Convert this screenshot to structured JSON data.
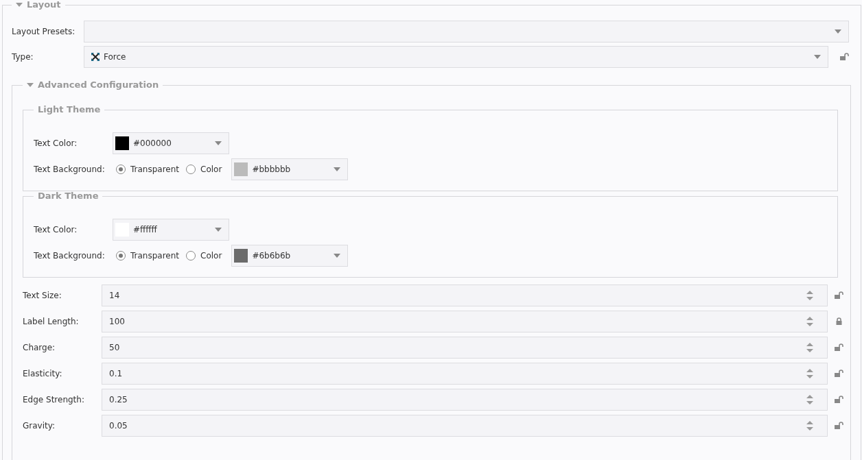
{
  "section": {
    "title": "Layout",
    "expanded": true
  },
  "presets": {
    "label": "Layout Presets:"
  },
  "type": {
    "label": "Type:",
    "value": "Force",
    "locked": false
  },
  "advanced": {
    "title": "Advanced Configuration",
    "expanded": true,
    "themes": [
      {
        "title": "Light Theme",
        "text_color": {
          "label": "Text Color:",
          "value": "#000000"
        },
        "text_background": {
          "label": "Text Background:",
          "options": [
            {
              "label": "Transparent",
              "selected": true
            },
            {
              "label": "Color",
              "selected": false
            }
          ],
          "value": "#bbbbbb"
        }
      },
      {
        "title": "Dark Theme",
        "text_color": {
          "label": "Text Color:",
          "value": "#ffffff"
        },
        "text_background": {
          "label": "Text Background:",
          "options": [
            {
              "label": "Transparent",
              "selected": true
            },
            {
              "label": "Color",
              "selected": false
            }
          ],
          "value": "#6b6b6b"
        }
      }
    ],
    "fields": [
      {
        "label": "Text Size:",
        "value": "14",
        "locked": false
      },
      {
        "label": "Label Length:",
        "value": "100",
        "locked": true
      },
      {
        "label": "Charge:",
        "value": "50",
        "locked": false
      },
      {
        "label": "Elasticity:",
        "value": "0.1",
        "locked": false
      },
      {
        "label": "Edge Strength:",
        "value": "0.25",
        "locked": false
      },
      {
        "label": "Gravity:",
        "value": "0.05",
        "locked": false
      }
    ]
  }
}
